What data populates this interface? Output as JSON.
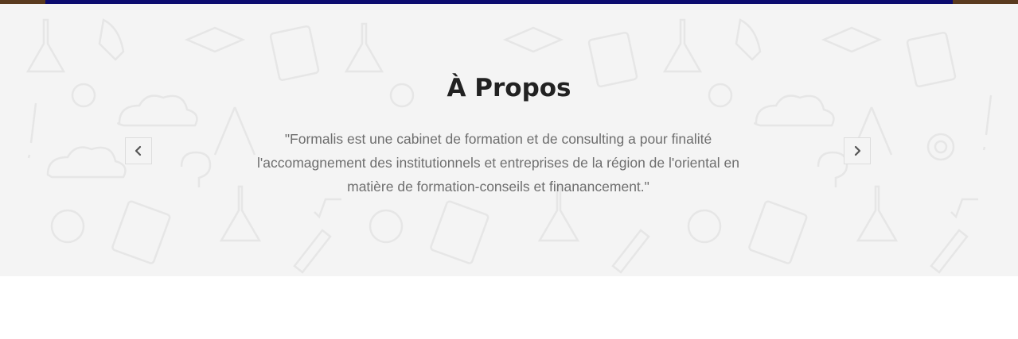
{
  "about": {
    "title": "À Propos",
    "quote": "\"Formalis est une cabinet de formation et de consulting a pour finalité l'accomagnement des institutionnels et entreprises de la région de l'oriental en matière de formation-conseils et finanancement.\""
  },
  "carousel": {
    "prev_icon": "chevron-left-icon",
    "next_icon": "chevron-right-icon"
  },
  "colors": {
    "section_background": "#f4f4f4",
    "top_bar": "#0b0b6e",
    "title": "#222222",
    "quote_text": "#6e6e6e"
  }
}
